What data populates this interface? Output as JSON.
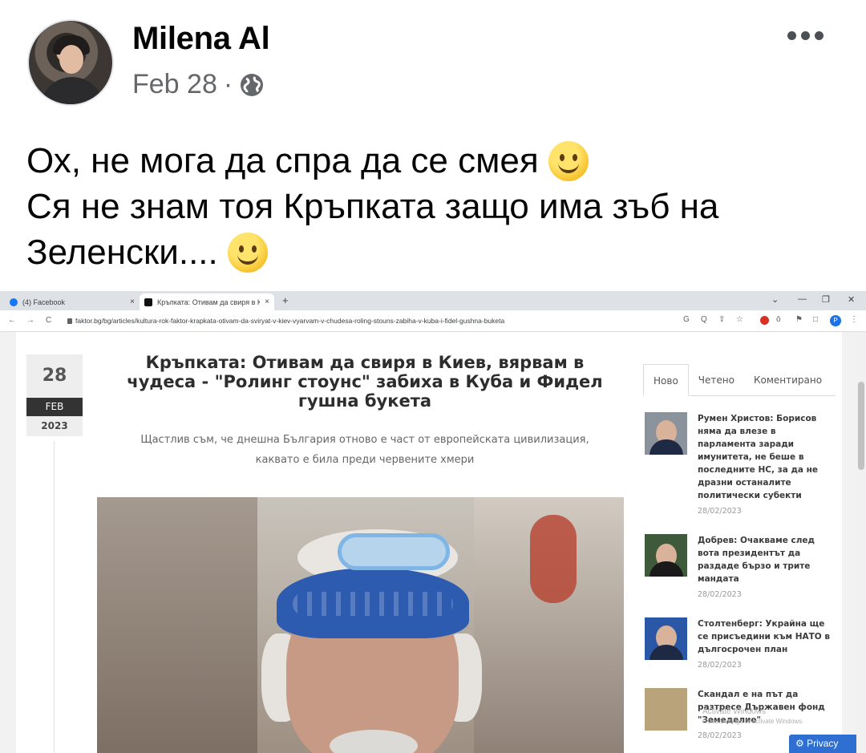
{
  "post": {
    "author": "Milena Al",
    "date": "Feb 28",
    "separator": "·",
    "privacy_icon": "globe-icon",
    "more_icon": "more-options-icon",
    "text_lines": [
      "Ох, не мога да спра да се смея",
      "Ся не знам тоя Кръпката защо има зъб на",
      "Зеленски...."
    ],
    "emoji": "slightly-smiling-face-icon"
  },
  "browser": {
    "tabs": [
      {
        "label": "(4) Facebook",
        "close": "×"
      },
      {
        "label": "Кръпката: Отивам да свиря в Ки",
        "close": "×"
      }
    ],
    "new_tab": "+",
    "window_controls": [
      "⌄",
      "—",
      "❐",
      "✕"
    ],
    "nav": [
      "←",
      "→",
      "C"
    ],
    "url": "faktor.bg/bg/articles/kultura-rok-faktor-krapkata-otivam-da-sviryat-v-kiev-vyarvam-v-chudesa-roling-stouns-zabiha-v-kuba-i-fidel-gushna-buketa",
    "toolbar": [
      "G",
      "Q",
      "⇪",
      "☆",
      "ō",
      "⚑",
      "□",
      "⋮"
    ],
    "profile": "P"
  },
  "article": {
    "date": {
      "day": "28",
      "month": "FEB",
      "year": "2023"
    },
    "headline_lines": [
      "Кръпката: Отивам да свиря в Киев, вярвам в",
      "чудеса - \"Ролинг стоунс\" забиха в Куба и Фидел",
      "гушна букета"
    ],
    "subhead_lines": [
      "Щастлив съм, че днешна България отново е част от европейската цивилизация,",
      "каквато е била преди червените хмери"
    ]
  },
  "sidebar": {
    "tabs": [
      "Ново",
      "Четено",
      "Коментирано"
    ],
    "news": [
      {
        "title": "Румен Христов: Борисов няма да влезе в парламента заради имунитета, не беше в последните НС, за да не дразни останалите политически субекти",
        "date": "28/02/2023"
      },
      {
        "title": "Добрев: Очакваме след вота президентът да раздаде бързо и трите мандата",
        "date": "28/02/2023"
      },
      {
        "title": "Столтенберг: Украйна ще се присъедини към НАТО в дългосрочен план",
        "date": "28/02/2023"
      },
      {
        "title": "Скандал е на път да разтресе Държавен фонд \"Земеделие\"",
        "date": "28/02/2023"
      }
    ]
  },
  "overlay": {
    "watermark_line1": "Activate Windows",
    "watermark_line2": "Go to Settings to activate Windows.",
    "privacy": "Privacy"
  }
}
